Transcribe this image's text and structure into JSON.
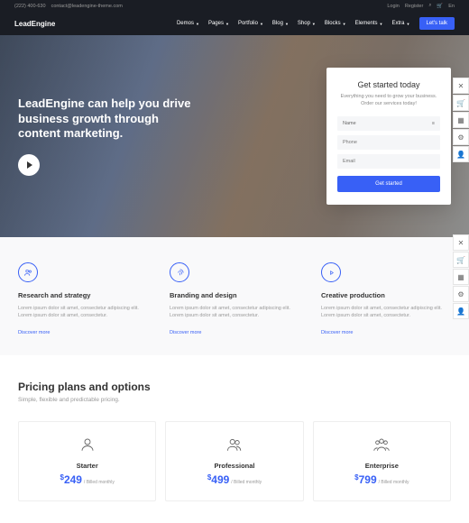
{
  "topbar": {
    "phone": "(222) 400-630",
    "email": "contact@leadengine-theme.com",
    "login": "Login",
    "register": "Register",
    "lang": "En"
  },
  "nav": {
    "logo": "LeadEngine",
    "items": [
      "Demos",
      "Pages",
      "Portfolio",
      "Blog",
      "Shop",
      "Blocks",
      "Elements",
      "Extra"
    ],
    "cta": "Let's talk"
  },
  "hero": {
    "title": "LeadEngine can help you drive business growth through content marketing."
  },
  "form": {
    "title": "Get started today",
    "sub": "Everything you need to grow your business. Order our services today!",
    "name": "Name",
    "phone": "Phone",
    "email": "Email",
    "btn": "Get started"
  },
  "features": [
    {
      "title": "Research and strategy",
      "desc": "Lorem ipsum dolor sit amet, consectetur adipiscing elit. Lorem ipsum dolor sit amet, consectetur.",
      "link": "Discover more"
    },
    {
      "title": "Branding and design",
      "desc": "Lorem ipsum dolor sit amet, consectetur adipiscing elit. Lorem ipsum dolor sit amet, consectetur.",
      "link": "Discover more"
    },
    {
      "title": "Creative production",
      "desc": "Lorem ipsum dolor sit amet, consectetur adipiscing elit. Lorem ipsum dolor sit amet, consectetur.",
      "link": "Discover more"
    }
  ],
  "pricing": {
    "title": "Pricing plans and options",
    "sub": "Simple, flexible and predictable pricing.",
    "plans": [
      {
        "name": "Starter",
        "price": "249",
        "period": "/ Billed monthly"
      },
      {
        "name": "Professional",
        "price": "499",
        "period": "/ Billed monthly"
      },
      {
        "name": "Enterprise",
        "price": "799",
        "period": "/ Billed monthly"
      }
    ]
  }
}
